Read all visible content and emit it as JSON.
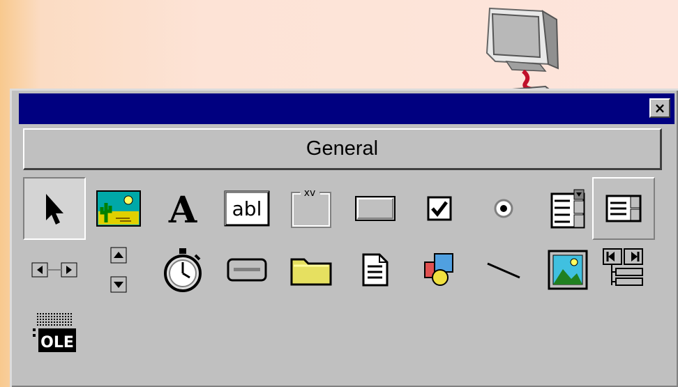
{
  "window": {
    "close_label": "×",
    "tab_label": "General"
  },
  "tools_row1": [
    {
      "name": "pointer-icon"
    },
    {
      "name": "picturebox-icon"
    },
    {
      "name": "label-icon",
      "glyph": "A"
    },
    {
      "name": "textbox-icon",
      "glyph": "abl"
    },
    {
      "name": "frame-icon",
      "glyph": "xv"
    },
    {
      "name": "commandbutton-icon"
    },
    {
      "name": "checkbox-icon"
    },
    {
      "name": "optionbutton-icon"
    },
    {
      "name": "combobox-icon"
    },
    {
      "name": "listbox-icon"
    }
  ],
  "tools_row2": [
    {
      "name": "hscrollbar-icon"
    },
    {
      "name": "vscrollbar-icon"
    },
    {
      "name": "timer-icon"
    },
    {
      "name": "drivelistbox-icon"
    },
    {
      "name": "dirlistbox-icon"
    },
    {
      "name": "filelistbox-icon"
    },
    {
      "name": "shape-icon"
    },
    {
      "name": "line-icon"
    },
    {
      "name": "image-icon"
    },
    {
      "name": "data-icon"
    }
  ],
  "tools_row3": [
    {
      "name": "ole-icon",
      "glyph": "OLE"
    }
  ],
  "colors": {
    "titlebar": "#000080",
    "panel": "#c0c0c0"
  }
}
